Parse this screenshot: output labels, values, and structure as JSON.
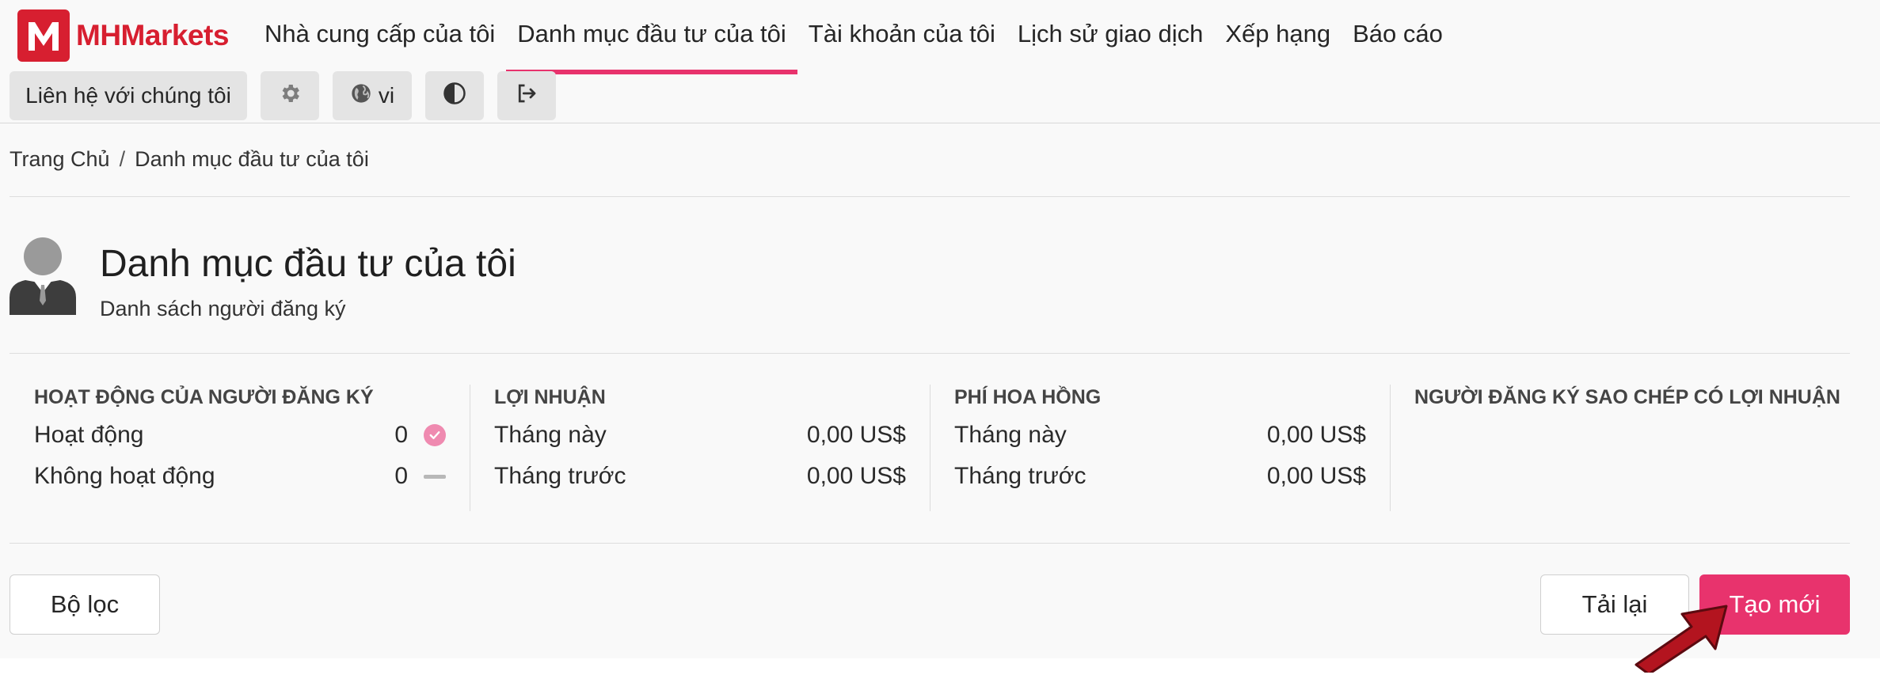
{
  "brand": {
    "name": "MHMarkets",
    "color": "#d71f30"
  },
  "nav": {
    "items": [
      {
        "label": "Nhà cung cấp của tôi",
        "active": false
      },
      {
        "label": "Danh mục đầu tư của tôi",
        "active": true
      },
      {
        "label": "Tài khoản của tôi",
        "active": false
      },
      {
        "label": "Lịch sử giao dịch",
        "active": false
      },
      {
        "label": "Xếp hạng",
        "active": false
      },
      {
        "label": "Báo cáo",
        "active": false
      }
    ]
  },
  "toolbar": {
    "contact_label": "Liên hệ với chúng tôi",
    "settings_icon": "gear-icon",
    "language_label": "vi",
    "language_icon": "globe-icon",
    "theme_icon": "contrast-icon",
    "logout_icon": "logout-icon"
  },
  "breadcrumb": {
    "home": "Trang Chủ",
    "separator": "/",
    "current": "Danh mục đầu tư của tôi"
  },
  "page": {
    "title": "Danh mục đầu tư của tôi",
    "subtitle": "Danh sách người đăng ký"
  },
  "stats": {
    "activity": {
      "heading": "HOẠT ĐỘNG CỦA NGƯỜI ĐĂNG KÝ",
      "active_label": "Hoạt động",
      "active_value": "0",
      "inactive_label": "Không hoạt động",
      "inactive_value": "0"
    },
    "profit": {
      "heading": "LỢI NHUẬN",
      "this_month_label": "Tháng này",
      "this_month_value": "0,00 US$",
      "last_month_label": "Tháng trước",
      "last_month_value": "0,00 US$"
    },
    "commission": {
      "heading": "PHÍ HOA HỒNG",
      "this_month_label": "Tháng này",
      "this_month_value": "0,00 US$",
      "last_month_label": "Tháng trước",
      "last_month_value": "0,00 US$"
    },
    "profitable_copiers": {
      "heading": "NGƯỜI ĐĂNG KÝ SAO CHÉP CÓ LỢI NHUẬN"
    }
  },
  "actions": {
    "filter_label": "Bộ lọc",
    "reload_label": "Tải lại",
    "create_label": "Tạo mới"
  },
  "colors": {
    "accent": "#e8336d",
    "annotation_arrow": "#b3141f"
  }
}
